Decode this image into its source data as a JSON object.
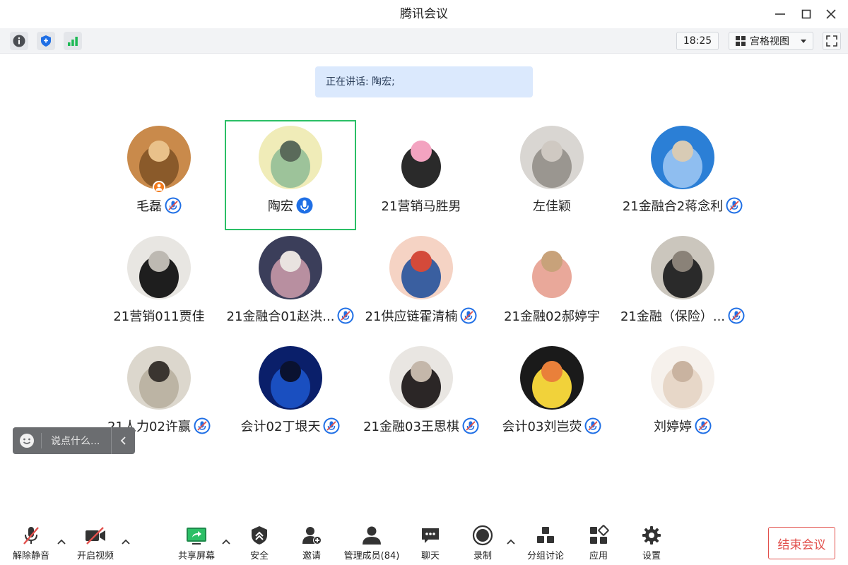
{
  "window": {
    "title": "腾讯会议"
  },
  "toolbar": {
    "time": "18:25",
    "view_label": "宫格视图"
  },
  "speaking_banner": "正在讲话: 陶宏;",
  "participants": [
    {
      "name": "毛磊",
      "mic": "muted",
      "host": true,
      "avatar": "bear-avatar"
    },
    {
      "name": "陶宏",
      "mic": "speaking",
      "active": true,
      "avatar": "lake-avatar"
    },
    {
      "name": "21营销马胜男",
      "mic": "none",
      "avatar": "kuromi-avatar"
    },
    {
      "name": "左佳颖",
      "mic": "none",
      "avatar": "girl-balcony-avatar"
    },
    {
      "name": "21金融合2蒋念利",
      "mic": "muted",
      "avatar": "plush-sky-avatar"
    },
    {
      "name": "21营销011贾佳",
      "mic": "none",
      "avatar": "panda-avatar"
    },
    {
      "name": "21金融合01赵洪...",
      "mic": "muted",
      "avatar": "astronaut-avatar"
    },
    {
      "name": "21供应链霍清楠",
      "mic": "muted",
      "avatar": "shinchan-avatar"
    },
    {
      "name": "21金融02郝婷宇",
      "mic": "none",
      "avatar": "cartoon-girl-avatar"
    },
    {
      "name": "21金融（保险）...",
      "mic": "muted",
      "avatar": "child-avatar"
    },
    {
      "name": "21人力02许赢",
      "mic": "muted",
      "avatar": "sheep-avatar"
    },
    {
      "name": "会计02丁垠天",
      "mic": "muted",
      "avatar": "blue-abstract-avatar"
    },
    {
      "name": "21金融03王思棋",
      "mic": "muted",
      "avatar": "girl-photo-avatar"
    },
    {
      "name": "会计03刘岂荧",
      "mic": "muted",
      "avatar": "duck-avatar"
    },
    {
      "name": "刘婷婷",
      "mic": "muted",
      "avatar": "kitten-avatar"
    }
  ],
  "chat": {
    "placeholder": "说点什么..."
  },
  "bottom": {
    "unmute": "解除静音",
    "start_video": "开启视频",
    "share_screen": "共享屏幕",
    "security": "安全",
    "invite": "邀请",
    "manage_members": "管理成员(84)",
    "chat": "聊天",
    "record": "录制",
    "breakout": "分组讨论",
    "apps": "应用",
    "settings": "设置",
    "end_meeting": "结束会议"
  },
  "colors": {
    "accent_blue": "#1f6fe5",
    "active_border": "#2bbf66",
    "end_red": "#e2504c",
    "banner_bg": "#dbe9fd"
  }
}
